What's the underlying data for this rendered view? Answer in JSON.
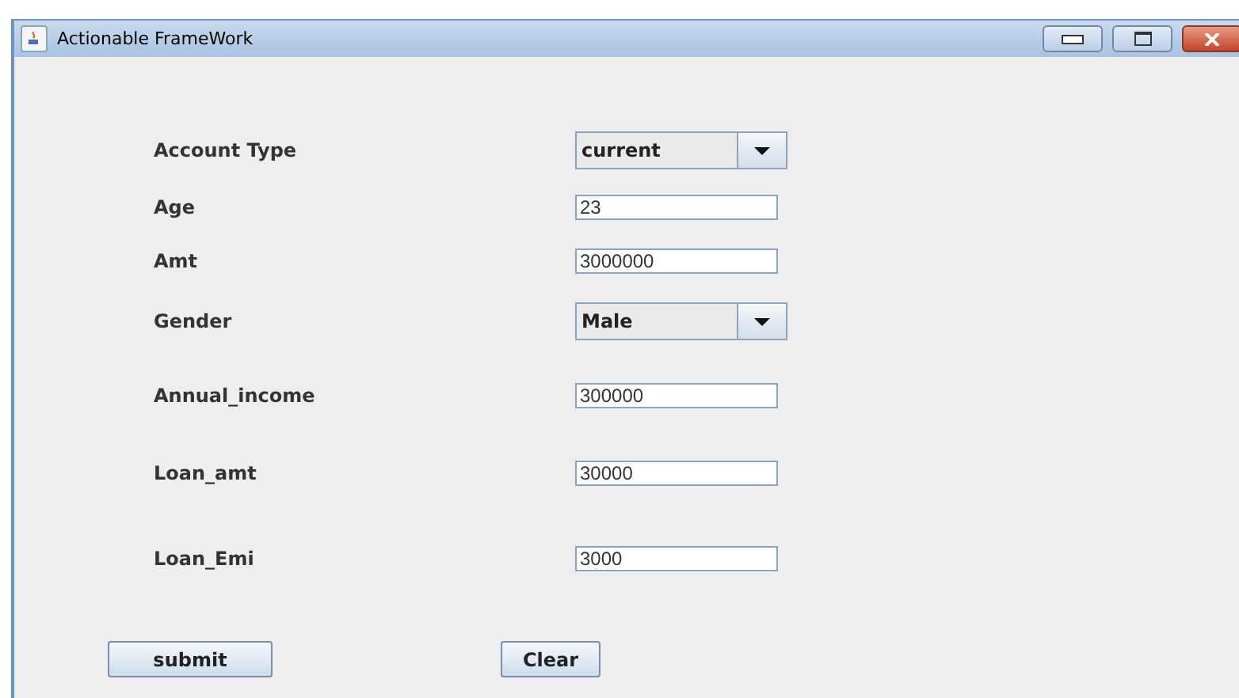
{
  "window": {
    "title": "Actionable FrameWork"
  },
  "fields": [
    {
      "kind": "combo",
      "label": "Account Type",
      "value": "current"
    },
    {
      "kind": "text",
      "label": "Age",
      "value": "23"
    },
    {
      "kind": "text",
      "label": "Amt",
      "value": "3000000"
    },
    {
      "kind": "combo",
      "label": "Gender",
      "value": "Male"
    },
    {
      "kind": "text",
      "label": "Annual_income",
      "value": "300000"
    },
    {
      "kind": "text",
      "label": "Loan_amt",
      "value": "30000"
    },
    {
      "kind": "text",
      "label": "Loan_Emi",
      "value": "3000"
    }
  ],
  "buttons": [
    "submit",
    "Clear"
  ]
}
